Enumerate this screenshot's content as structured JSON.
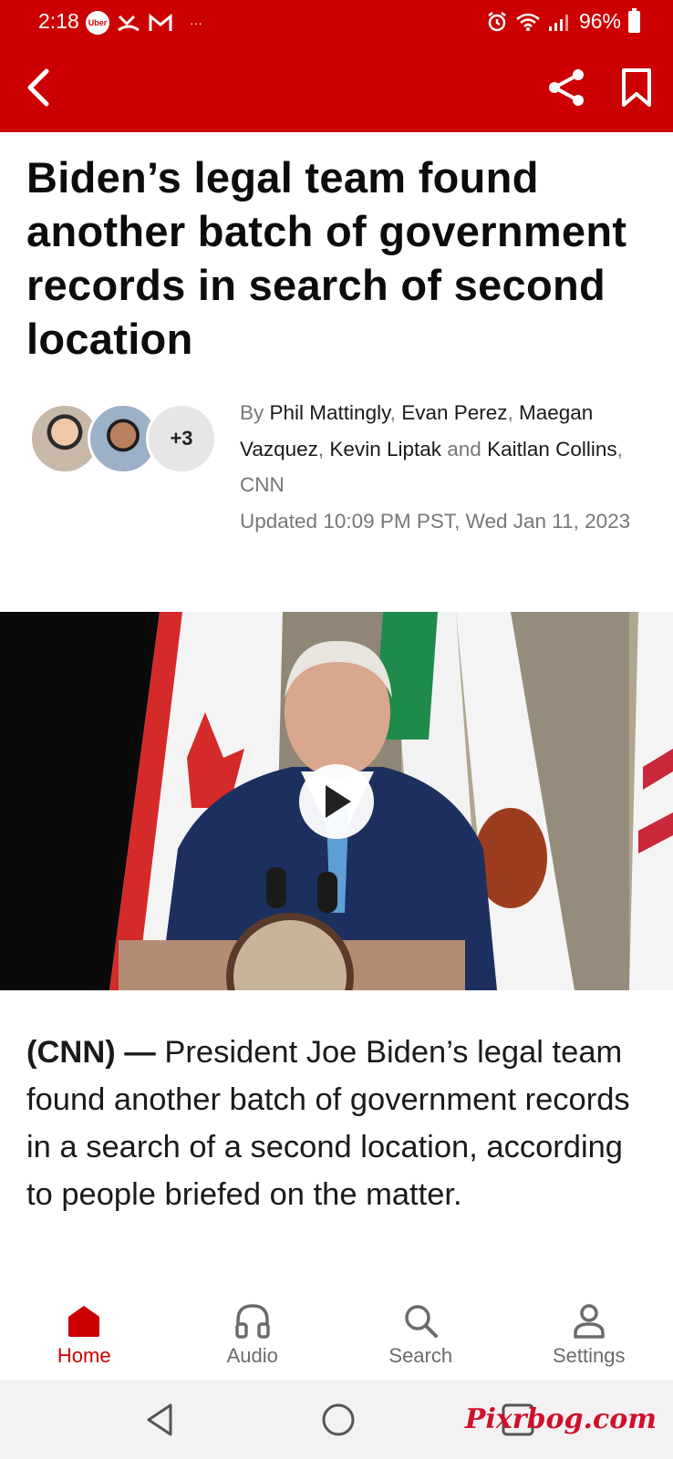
{
  "status_bar": {
    "time": "2:18",
    "uber_label": "Uber",
    "more_notifications": "···",
    "battery": "96%"
  },
  "article": {
    "headline": "Biden’s legal team found another batch of government records in search of second location",
    "byline": {
      "by": "By",
      "authors": [
        "Phil Mattingly",
        "Evan Perez",
        "Maegan Vazquez",
        "Kevin Liptak",
        "Kaitlan Collins"
      ],
      "conjunction": "and",
      "source": "CNN",
      "more_authors_badge": "+3",
      "updated": "Updated 10:09 PM PST, Wed Jan 11, 2023"
    },
    "dateline": "(CNN) —",
    "paragraph": "President Joe Biden’s legal team found another batch of government records in a search of a second location, according to people briefed on the matter."
  },
  "bottom_nav": {
    "items": [
      {
        "label": "Home",
        "icon": "home-icon",
        "active": true
      },
      {
        "label": "Audio",
        "icon": "headphones-icon",
        "active": false
      },
      {
        "label": "Search",
        "icon": "search-icon",
        "active": false
      },
      {
        "label": "Settings",
        "icon": "person-icon",
        "active": false
      }
    ]
  },
  "watermark": "Pixrbog.com",
  "colors": {
    "brand_red": "#cc0000",
    "nav_inactive": "#6b6b6b",
    "meta_gray": "#777777"
  }
}
